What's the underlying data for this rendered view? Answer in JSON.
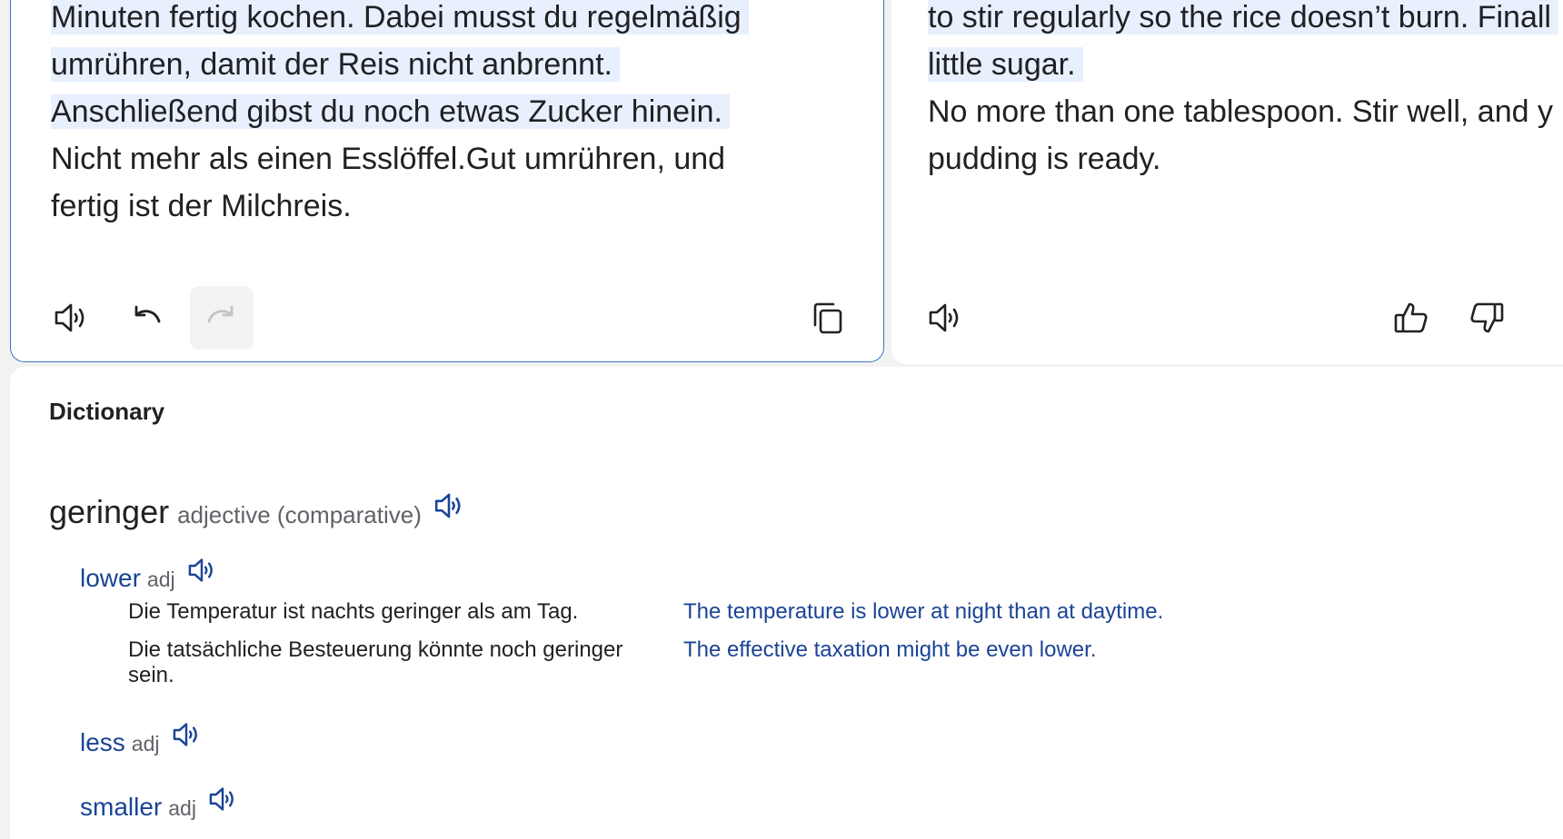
{
  "source": {
    "lines": [
      {
        "text": "Minuten fertig kochen. Dabei musst du regelmäßig",
        "highlighted": true
      },
      {
        "text": "umrühren, damit der Reis nicht anbrennt.",
        "highlighted": true
      },
      {
        "text": "Anschließend gibst du noch etwas Zucker hinein.",
        "highlighted": true
      },
      {
        "text": "Nicht mehr als einen Esslöffel.Gut umrühren, und",
        "highlighted": false
      },
      {
        "text": "fertig ist der Milchreis.",
        "highlighted": false
      }
    ],
    "toolbar": {
      "icons": [
        "speaker-icon",
        "undo-icon",
        "redo-icon",
        "copy-icon"
      ],
      "redo_disabled": true
    }
  },
  "target": {
    "lines": [
      {
        "text": "to stir regularly so the rice doesn’t burn. Finall",
        "highlighted": true
      },
      {
        "text": "little sugar.",
        "highlighted": true
      },
      {
        "text": "No more than one tablespoon. Stir well, and y",
        "highlighted": false
      },
      {
        "text": "pudding is ready.",
        "highlighted": false
      }
    ],
    "toolbar": {
      "icons": [
        "speaker-icon",
        "thumbs-up-icon",
        "thumbs-down-icon"
      ]
    }
  },
  "dictionary": {
    "title": "Dictionary",
    "headword": "geringer",
    "headword_pos": "adjective (comparative)",
    "senses": [
      {
        "word": "lower",
        "pos": "adj",
        "examples": [
          {
            "de": "Die Temperatur ist nachts geringer als am Tag.",
            "en": "The temperature is lower at night than at daytime."
          },
          {
            "de": "Die tatsächliche Besteuerung könnte noch geringer sein.",
            "en": "The effective taxation might be even lower."
          }
        ]
      },
      {
        "word": "less",
        "pos": "adj",
        "examples": []
      },
      {
        "word": "smaller",
        "pos": "adj",
        "examples": []
      }
    ]
  },
  "colors": {
    "accent_blue": "#1a4496",
    "panel_border": "#3c74c9",
    "highlight": "#e8f0fe"
  }
}
